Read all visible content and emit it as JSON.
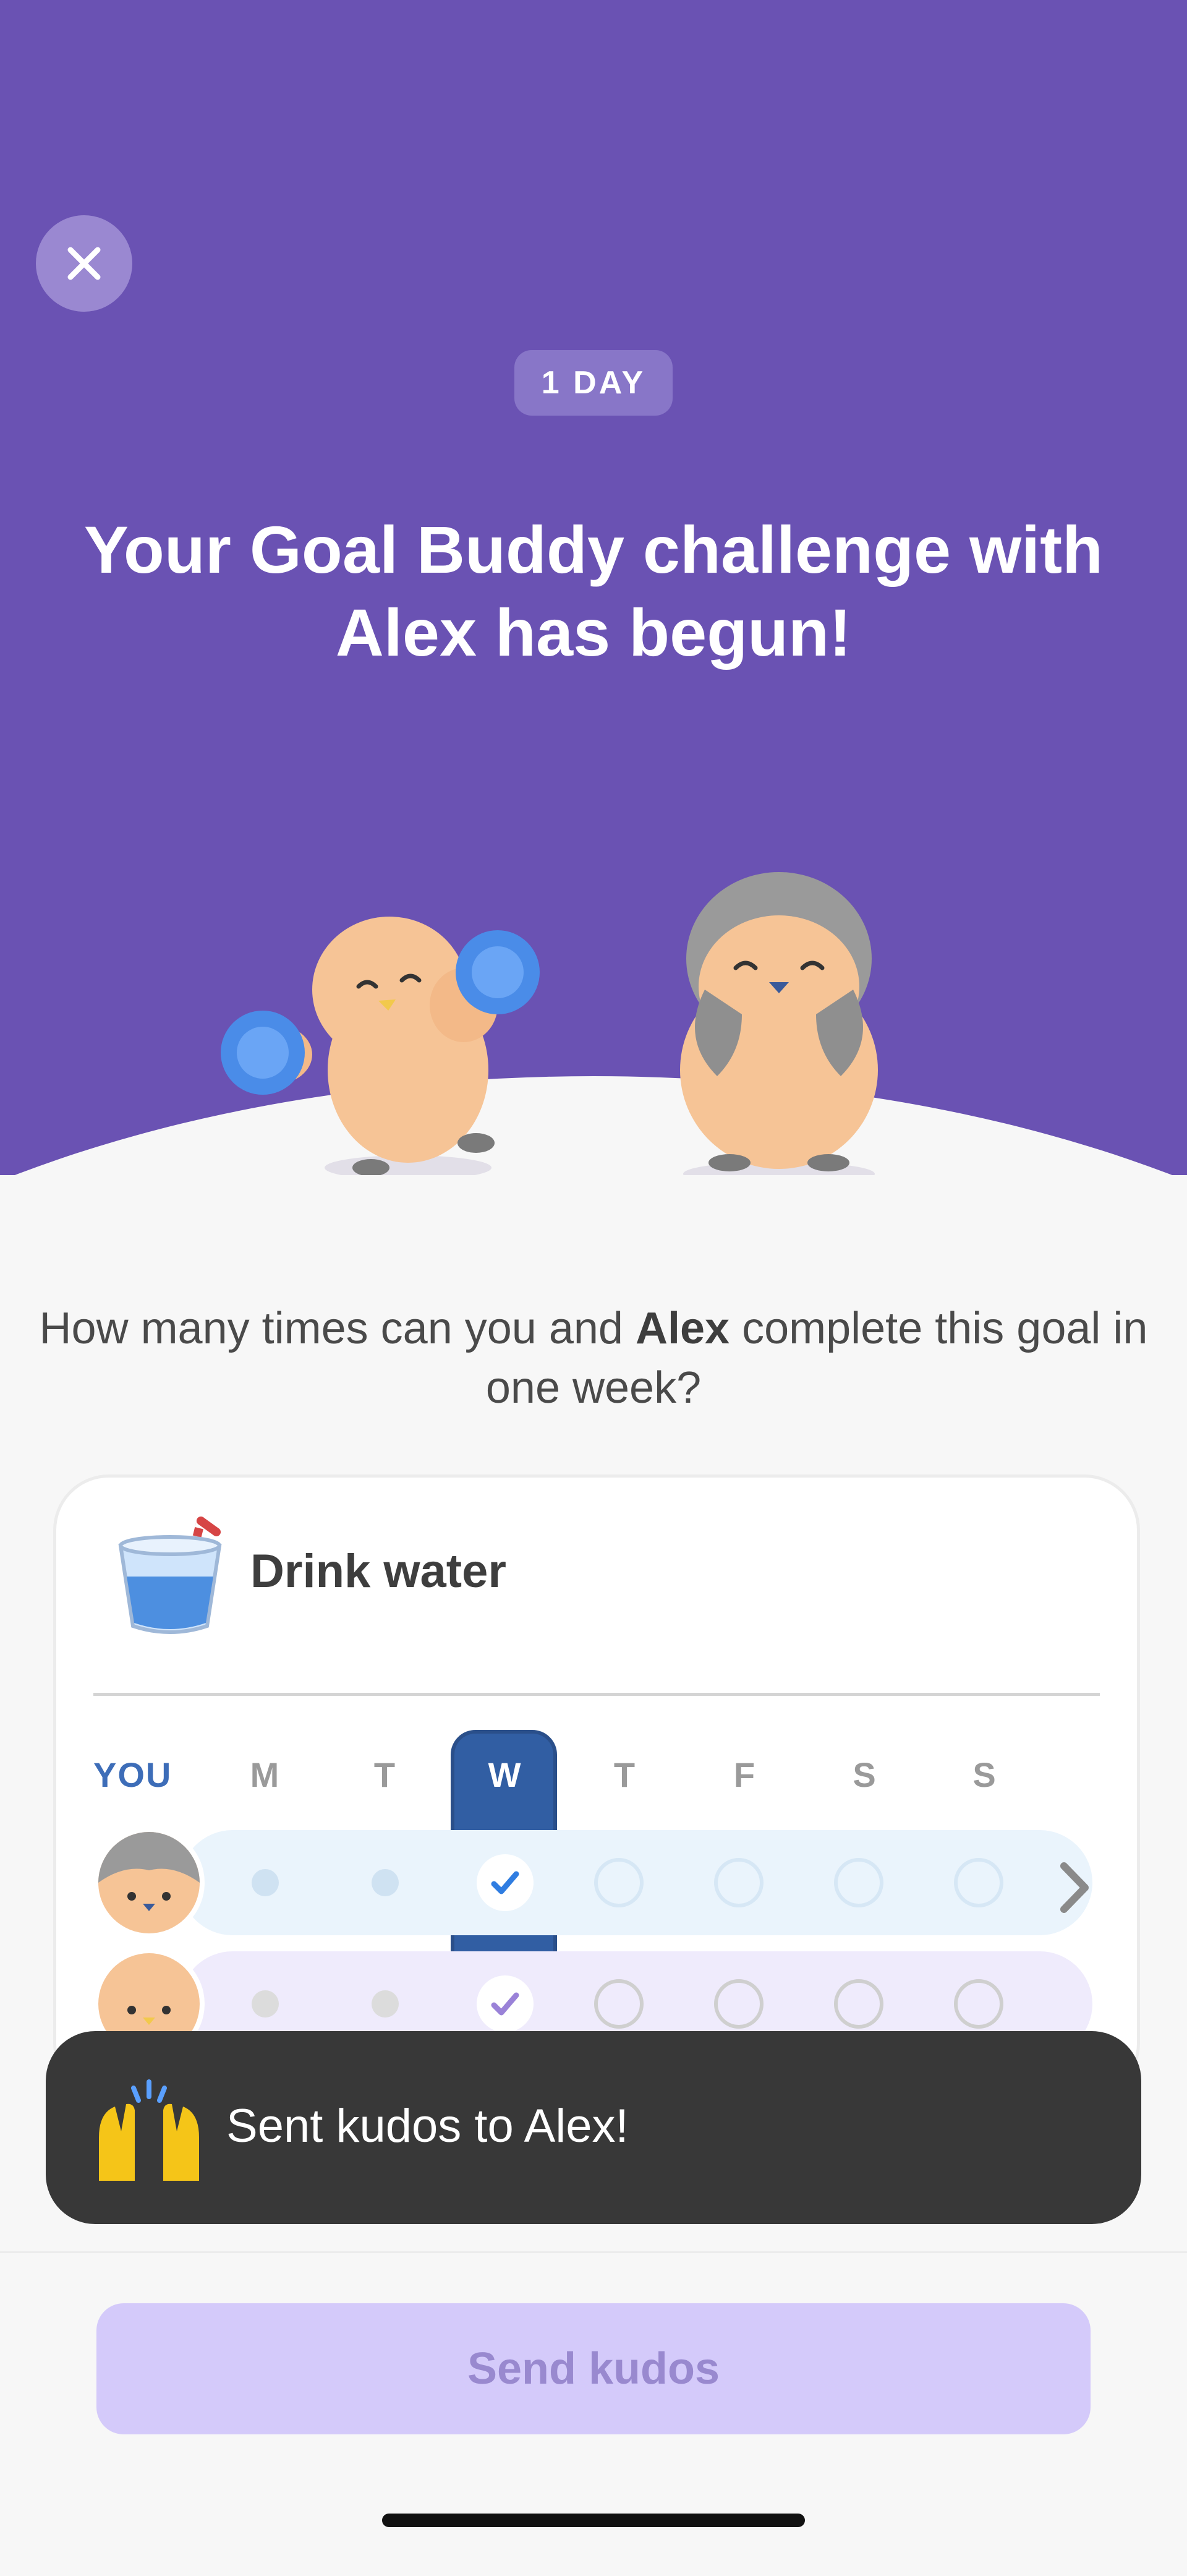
{
  "header": {
    "close_icon": "close-icon",
    "day_badge": "1 DAY",
    "headline": "Your Goal Buddy challenge with Alex has begun!"
  },
  "question": {
    "prefix": "How many times can you and ",
    "buddy_name": "Alex",
    "suffix": " complete this goal in one week?"
  },
  "goal_card": {
    "goal_icon": "water-glass-icon",
    "goal_title": "Drink water",
    "you_label": "YOU",
    "days": [
      "M",
      "T",
      "W",
      "T",
      "F",
      "S",
      "S"
    ],
    "current_day_index": 2,
    "rows": [
      {
        "owner": "You",
        "avatar": "penguin-avatar",
        "completed_days": [
          2
        ]
      },
      {
        "owner": "Alex",
        "avatar": "chick-avatar",
        "completed_days": [
          2
        ]
      }
    ],
    "next_icon": "chevron-right-icon"
  },
  "toast": {
    "emoji": "raised-hands-icon",
    "message": "Sent kudos to Alex!"
  },
  "footer": {
    "send_button_label": "Send kudos"
  },
  "colors": {
    "hero_purple": "#6a52b3",
    "toast_bg": "#383838",
    "button_bg": "#d4cafa",
    "you_blue": "#3d6db8",
    "current_day_blue": "#315ea3"
  }
}
